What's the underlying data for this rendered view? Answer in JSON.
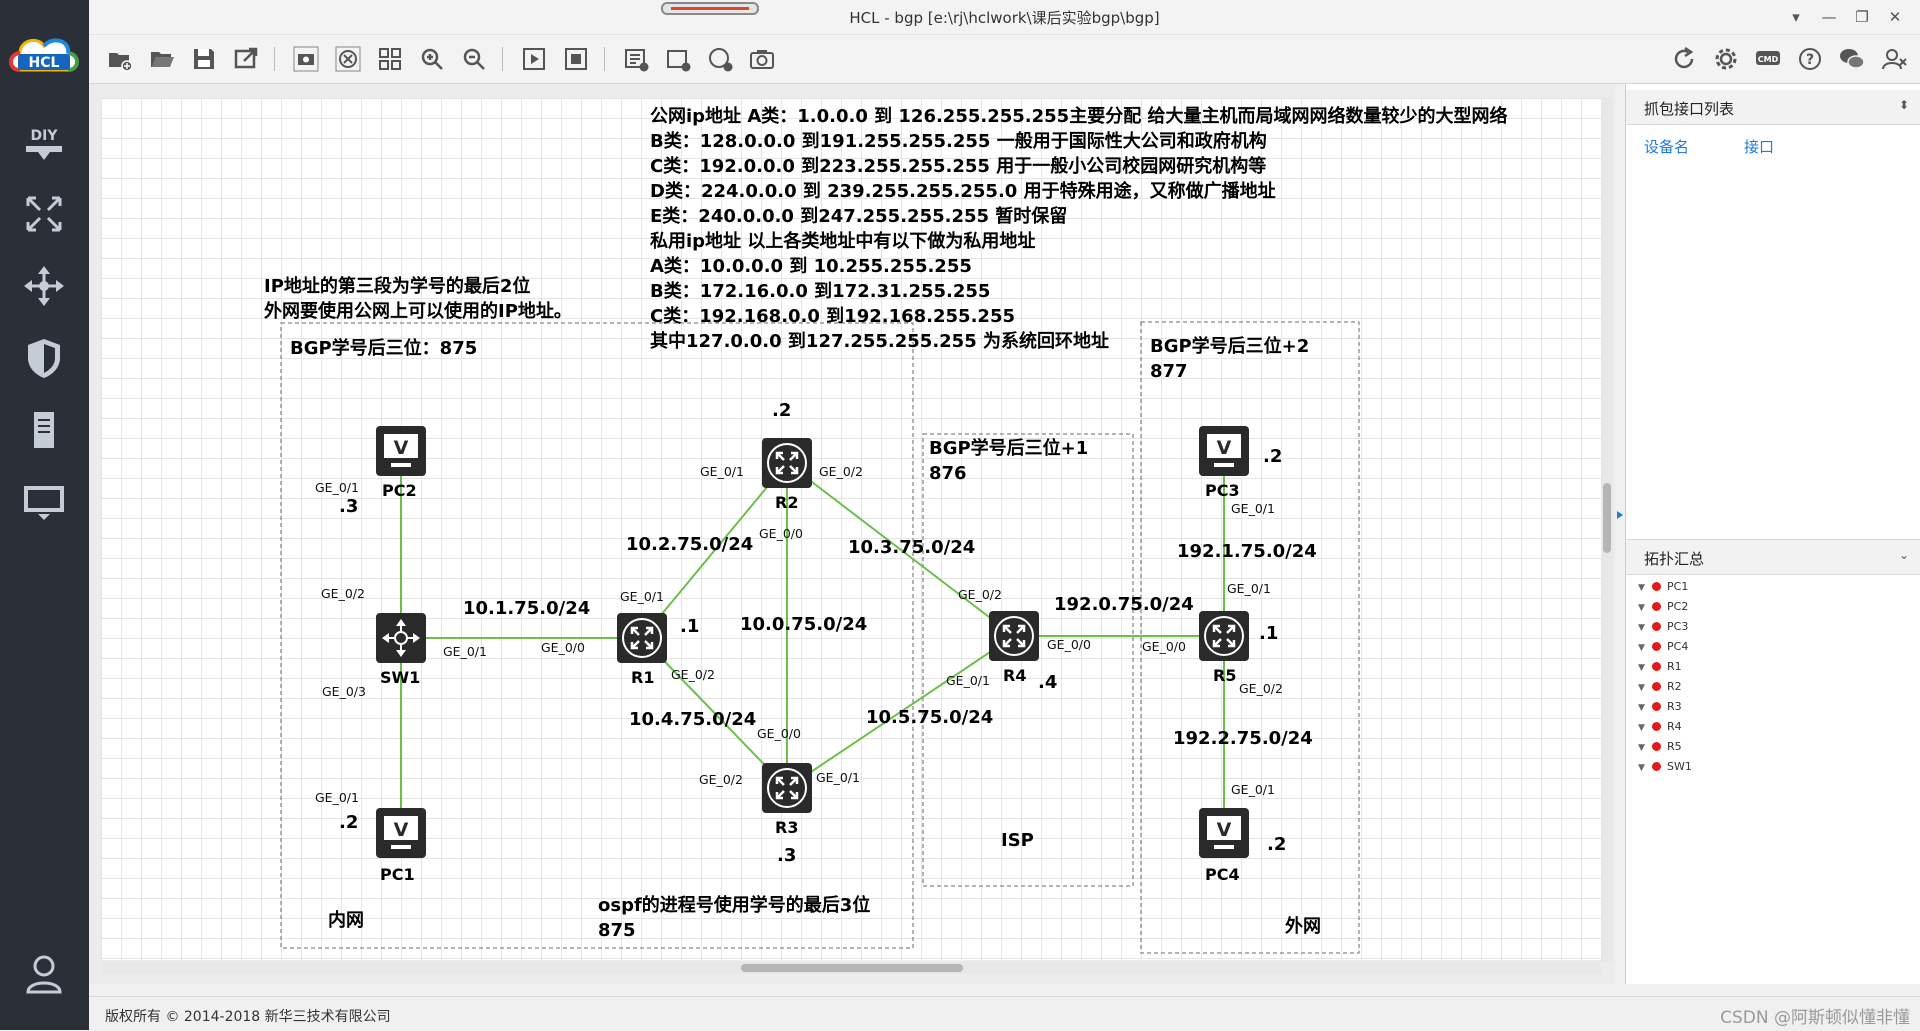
{
  "app": {
    "logo_text": "HCL",
    "title": "HCL - bgp [e:\\rj\\hclwork\\课后实验bgp\\bgp]",
    "sidebar_icons": [
      "diy-icon",
      "topology-icon",
      "move-icon",
      "shield-icon",
      "server-icon",
      "monitor-icon",
      "user-icon"
    ],
    "sidebar_diy": "DIY"
  },
  "canvas": {
    "notes": {
      "ip_classes": [
        "公网ip地址 A类：1.0.0.0 到 126.255.255.255主要分配 给大量主机而局域网网络数量较少的大型网络",
        " B类：128.0.0.0 到191.255.255.255 一般用于国际性大公司和政府机构",
        "C类：192.0.0.0 到223.255.255.255 用于一般小公司校园网研究机构等",
        "D类：224.0.0.0 到 239.255.255.255.0 用于特殊用途，又称做广播地址",
        "E类：240.0.0.0 到247.255.255.255 暂时保留",
        "私用ip地址 以上各类地址中有以下做为私用地址",
        "A类：10.0.0.0 到 10.255.255.255",
        "B类：172.16.0.0 到172.31.255.255",
        "C类：192.168.0.0 到192.168.255.255",
        "其中127.0.0.0 到127.255.255.255 为系统回环地址"
      ],
      "ip_rule_1": "IP地址的第三段为学号的最后2位",
      "ip_rule_2": "外网要使用公网上可以使用的IP地址。",
      "bgp_inner": "BGP学号后三位：875",
      "bgp_isp_1": "BGP学号后三位+1",
      "bgp_isp_2": "876",
      "bgp_outer_1": "BGP学号后三位+2",
      "bgp_outer_2": "877",
      "ospf_1": "ospf的进程号使用学号的最后3位",
      "ospf_2": "875"
    },
    "zones": {
      "inner": "内网",
      "isp": "ISP",
      "outer": "外网"
    },
    "devices": {
      "pc1": "PC1",
      "pc2": "PC2",
      "pc3": "PC3",
      "pc4": "PC4",
      "sw1": "SW1",
      "r1": "R1",
      "r2": "R2",
      "r3": "R3",
      "r4": "R4",
      "r5": "R5"
    },
    "networks": {
      "n1": "10.1.75.0/24",
      "n2": "10.2.75.0/24",
      "n3": "10.3.75.0/24",
      "n0": "10.0.75.0/24",
      "n4": "10.4.75.0/24",
      "n5": "10.5.75.0/24",
      "n192_0": "192.0.75.0/24",
      "n192_1": "192.1.75.0/24",
      "n192_2": "192.2.75.0/24"
    },
    "hosts": {
      "pc2": ".3",
      "pc1": ".2",
      "r1": ".1",
      "r2": ".2",
      "r3": ".3",
      "r4": ".4",
      "r5": ".1",
      "pc3": ".2",
      "pc4": ".2"
    },
    "ports": {
      "pc2_g01": "GE_0/1",
      "sw1_g02": "GE_0/2",
      "sw1_g01": "GE_0/1",
      "sw1_g03": "GE_0/3",
      "pc1_g01": "GE_0/1",
      "r1_g00": "GE_0/0",
      "r1_g01": "GE_0/1",
      "r1_g02": "GE_0/2",
      "r2_g01": "GE_0/1",
      "r2_g02": "GE_0/2",
      "r2_g00": "GE_0/0",
      "r3_g00": "GE_0/0",
      "r3_g02": "GE_0/2",
      "r3_g01": "GE_0/1",
      "r4_g02": "GE_0/2",
      "r4_g00": "GE_0/0",
      "r4_g01": "GE_0/1",
      "r5_g00": "GE_0/0",
      "r5_g01": "GE_0/1",
      "r5_g02": "GE_0/2",
      "pc3_g01": "GE_0/1",
      "pc4_g01": "GE_0/1"
    }
  },
  "right_panel": {
    "capture_title": "抓包接口列表",
    "col_device": "设备名",
    "col_interface": "接口",
    "topo_title": "拓扑汇总",
    "topo_items": [
      "PC1",
      "PC2",
      "PC3",
      "PC4",
      "R1",
      "R2",
      "R3",
      "R4",
      "R5",
      "SW1"
    ]
  },
  "status": {
    "copyright": "版权所有 © 2014-2018 新华三技术有限公司",
    "watermark": "CSDN @阿斯顿似懂非懂"
  },
  "colors": {
    "link": "#6cc04a",
    "sidebar": "#2b3038",
    "accent": "#1f7cd6",
    "device": "#2a2a2a"
  }
}
